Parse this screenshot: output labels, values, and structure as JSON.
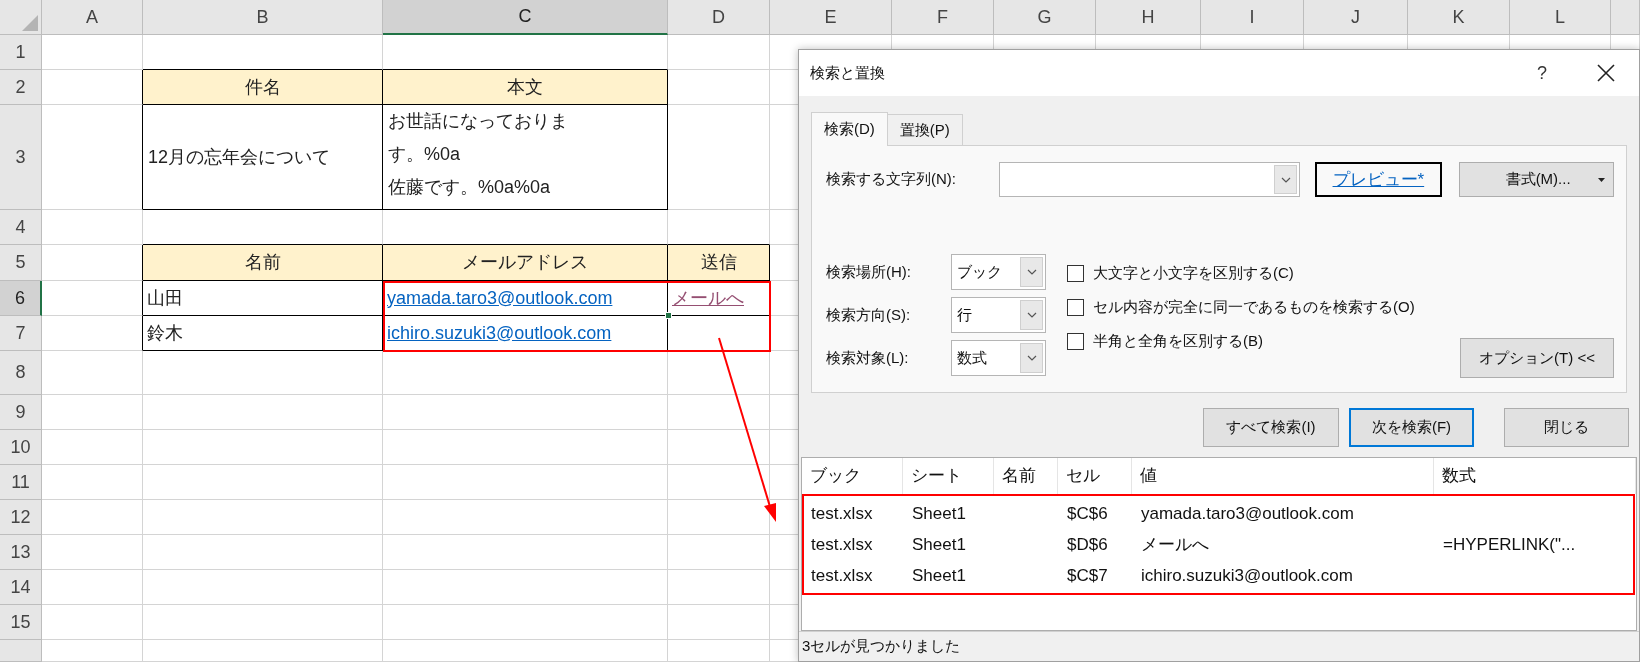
{
  "sheet": {
    "columns": [
      {
        "label": "A",
        "selected": false
      },
      {
        "label": "B",
        "selected": false
      },
      {
        "label": "C",
        "selected": true
      },
      {
        "label": "D",
        "selected": false
      },
      {
        "label": "E",
        "selected": false
      },
      {
        "label": "F",
        "selected": false
      },
      {
        "label": "G",
        "selected": false
      },
      {
        "label": "H",
        "selected": false
      },
      {
        "label": "I",
        "selected": false
      },
      {
        "label": "J",
        "selected": false
      },
      {
        "label": "K",
        "selected": false
      },
      {
        "label": "L",
        "selected": false
      }
    ],
    "rows": [
      {
        "label": "1",
        "selected": false
      },
      {
        "label": "2",
        "selected": false
      },
      {
        "label": "3",
        "selected": false
      },
      {
        "label": "4",
        "selected": false
      },
      {
        "label": "5",
        "selected": false
      },
      {
        "label": "6",
        "selected": true
      },
      {
        "label": "7",
        "selected": false
      },
      {
        "label": "8",
        "selected": false
      },
      {
        "label": "9",
        "selected": false
      },
      {
        "label": "10",
        "selected": false
      },
      {
        "label": "11",
        "selected": false
      },
      {
        "label": "12",
        "selected": false
      },
      {
        "label": "13",
        "selected": false
      },
      {
        "label": "14",
        "selected": false
      },
      {
        "label": "15",
        "selected": false
      }
    ],
    "subject_table": {
      "headers": [
        "件名",
        "本文"
      ],
      "subject": "12月の忘年会について",
      "body_lines": [
        "お世話になっておりま",
        "す。%0a",
        "佐藤です。%0a%0a"
      ]
    },
    "mail_table": {
      "headers": [
        "名前",
        "メールアドレス",
        "送信"
      ],
      "rows": [
        [
          {
            "text": "山田",
            "kind": "text"
          },
          {
            "text": "yamada.taro3@outlook.com",
            "kind": "link"
          },
          {
            "text": "メールへ",
            "kind": "visited_link"
          }
        ],
        [
          {
            "text": "鈴木",
            "kind": "text"
          },
          {
            "text": "ichiro.suzuki3@outlook.com",
            "kind": "link"
          }
        ]
      ]
    }
  },
  "dialog": {
    "title": "検索と置換",
    "help": "?",
    "tabs": [
      {
        "label": "検索(D)",
        "selected": true
      },
      {
        "label": "置換(P)",
        "selected": false
      }
    ],
    "find_label": "検索する文字列(N):",
    "preview": "プレビュー*",
    "format_button": "書式(M)...",
    "dropdowns": [
      {
        "label": "検索場所(H):",
        "value": "ブック"
      },
      {
        "label": "検索方向(S):",
        "value": "行"
      },
      {
        "label": "検索対象(L):",
        "value": "数式"
      }
    ],
    "checkboxes": [
      {
        "label": "大文字と小文字を区別する(C)",
        "checked": false
      },
      {
        "label": "セル内容が完全に同一であるものを検索する(O)",
        "checked": false
      },
      {
        "label": "半角と全角を区別する(B)",
        "checked": false
      }
    ],
    "options_button": "オプション(T) <<",
    "buttons": [
      {
        "label": "すべて検索(I)",
        "default": false
      },
      {
        "label": "次を検索(F)",
        "default": true
      },
      {
        "label": "閉じる",
        "default": false
      }
    ],
    "results": {
      "columns": [
        "ブック",
        "シート",
        "名前",
        "セル",
        "値",
        "数式"
      ],
      "rows": [
        [
          "test.xlsx",
          "Sheet1",
          null,
          "$C$6",
          "yamada.taro3@outlook.com",
          null
        ],
        [
          "test.xlsx",
          "Sheet1",
          null,
          "$D$6",
          "メールへ",
          "=HYPERLINK(\"..."
        ],
        [
          "test.xlsx",
          "Sheet1",
          null,
          "$C$7",
          "ichiro.suzuki3@outlook.com",
          null
        ]
      ]
    },
    "status": "3セルが見つかりました"
  }
}
